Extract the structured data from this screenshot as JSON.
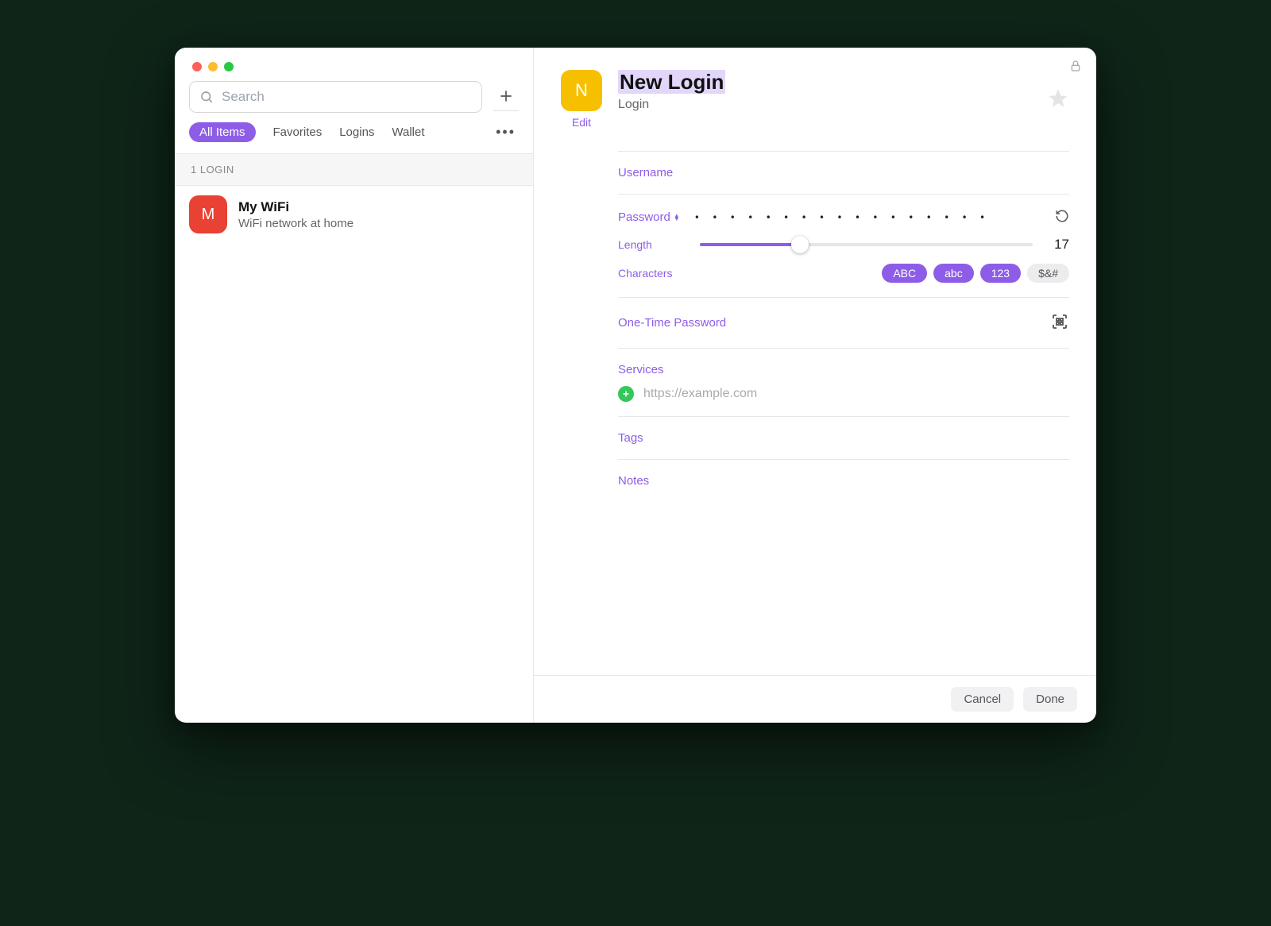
{
  "sidebar": {
    "search_placeholder": "Search",
    "filters": {
      "all": "All Items",
      "favorites": "Favorites",
      "logins": "Logins",
      "wallet": "Wallet"
    },
    "section_header": "1 LOGIN",
    "items": [
      {
        "initial": "M",
        "title": "My WiFi",
        "subtitle": "WiFi network at home",
        "badge_color": "#e94133"
      }
    ]
  },
  "detail": {
    "badge_initial": "N",
    "badge_color": "#f6c000",
    "edit_link": "Edit",
    "title": "New Login",
    "type": "Login",
    "fields": {
      "username_label": "Username",
      "password_label": "Password",
      "password_masked": "• • • • • • • • • • • • • • • • •",
      "length_label": "Length",
      "length_value": "17",
      "length_percent": 30,
      "characters_label": "Characters",
      "char_options": {
        "upper": "ABC",
        "lower": "abc",
        "digits": "123",
        "symbols": "$&#"
      },
      "otp_label": "One-Time Password",
      "services_label": "Services",
      "services_placeholder": "https://example.com",
      "tags_label": "Tags",
      "notes_label": "Notes"
    }
  },
  "footer": {
    "cancel": "Cancel",
    "done": "Done"
  }
}
